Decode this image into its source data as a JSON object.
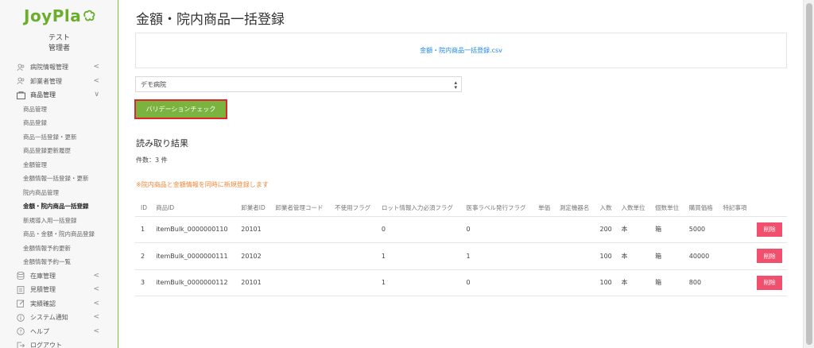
{
  "app": {
    "logo_text": "JoyPla"
  },
  "user": {
    "org": "テスト",
    "role": "管理者"
  },
  "sidebar": {
    "items": [
      {
        "label": "病院情報管理",
        "icon": "users-icon",
        "chevron": "<"
      },
      {
        "label": "卸業者管理",
        "icon": "users-icon",
        "chevron": "<"
      },
      {
        "label": "商品管理",
        "icon": "folder-icon",
        "chevron": "∨"
      }
    ],
    "subitems": [
      {
        "label": "商品管理"
      },
      {
        "label": "商品登録"
      },
      {
        "label": "商品一括登録・更新"
      },
      {
        "label": "商品登録更新履歴"
      },
      {
        "label": "金額管理"
      },
      {
        "label": "金額情報一括登録・更新"
      },
      {
        "label": "院内商品管理"
      },
      {
        "label": "金額・院内商品一括登録"
      },
      {
        "label": "新規導入用一括登録"
      },
      {
        "label": "商品・金額・院内商品登録"
      },
      {
        "label": "金額情報予約更新"
      },
      {
        "label": "金額情報予約一覧"
      }
    ],
    "bottom_items": [
      {
        "label": "在庫管理",
        "icon": "database-icon",
        "chevron": "<"
      },
      {
        "label": "見積管理",
        "icon": "file-icon",
        "chevron": "<"
      },
      {
        "label": "実績確認",
        "icon": "edit-icon",
        "chevron": "<"
      },
      {
        "label": "システム通知",
        "icon": "info-icon",
        "chevron": "<"
      },
      {
        "label": "ヘルプ",
        "icon": "help-icon",
        "chevron": "<"
      },
      {
        "label": "ログアウト",
        "icon": "logout-icon",
        "chevron": ""
      }
    ]
  },
  "main": {
    "title": "金額・院内商品一括登録",
    "file_link": "金額・院内商品一括登録.csv",
    "hospital_select": {
      "value": "デモ病院"
    },
    "validate_button": "バリデーションチェック",
    "result_title": "読み取り結果",
    "count_text": "件数：3 件",
    "warning": "※院内商品と金額情報を同時に新規登録します"
  },
  "table": {
    "headers": [
      "ID",
      "商品ID",
      "卸業者ID",
      "卸業者管理コード",
      "不使用フラグ",
      "ロット情報入力必須フラグ",
      "医事ラベル発行フラグ",
      "単価",
      "測定機器名",
      "入数",
      "入数単位",
      "個数単位",
      "購買価格",
      "特記事項",
      ""
    ],
    "rows": [
      {
        "id": "1",
        "item_id": "itemBulk_0000000110",
        "distributor_id": "20101",
        "distributor_code": "",
        "unused_flag": "",
        "lot_flag": "0",
        "label_flag": "0",
        "unit_price": "",
        "device": "",
        "quantity": "200",
        "quantity_unit": "本",
        "item_unit": "箱",
        "price": "5000",
        "notes": "",
        "delete_label": "削除"
      },
      {
        "id": "2",
        "item_id": "itemBulk_0000000111",
        "distributor_id": "20102",
        "distributor_code": "",
        "unused_flag": "",
        "lot_flag": "1",
        "label_flag": "1",
        "unit_price": "",
        "device": "",
        "quantity": "100",
        "quantity_unit": "本",
        "item_unit": "箱",
        "price": "40000",
        "notes": "",
        "delete_label": "削除"
      },
      {
        "id": "3",
        "item_id": "itemBulk_0000000112",
        "distributor_id": "20101",
        "distributor_code": "",
        "unused_flag": "",
        "lot_flag": "1",
        "label_flag": "0",
        "unit_price": "",
        "device": "",
        "quantity": "100",
        "quantity_unit": "本",
        "item_unit": "箱",
        "price": "800",
        "notes": "",
        "delete_label": "削除"
      }
    ]
  },
  "colors": {
    "brand": "#6aae2b",
    "button": "#7ab33e",
    "highlight": "#e0242c",
    "danger": "#f0506e",
    "link": "#1e87f0",
    "warning": "#f0883a"
  }
}
